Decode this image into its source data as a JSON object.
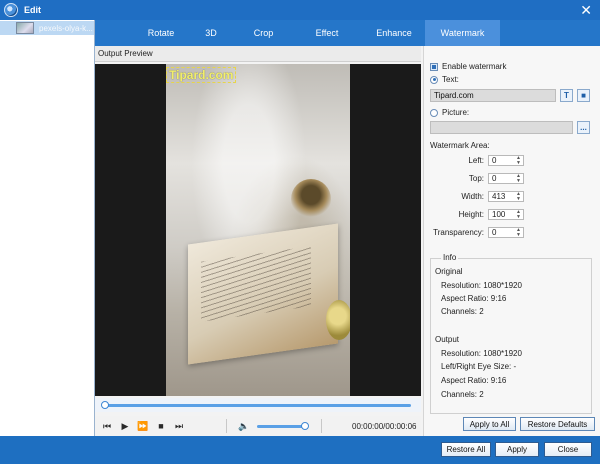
{
  "window": {
    "title": "Edit"
  },
  "file_list": {
    "items": [
      {
        "name": "pexels-olya-k..."
      }
    ]
  },
  "tabs": [
    {
      "label": "Rotate",
      "active": false
    },
    {
      "label": "3D",
      "active": false
    },
    {
      "label": "Crop",
      "active": false
    },
    {
      "label": "Effect",
      "active": false
    },
    {
      "label": "Enhance",
      "active": false
    },
    {
      "label": "Watermark",
      "active": true
    }
  ],
  "preview": {
    "header": "Output Preview",
    "watermark_text": "Tipard.com"
  },
  "playback": {
    "time": "00:00:00/00:00:06",
    "seek_progress": 0.0,
    "volume_level": 1.0
  },
  "watermark": {
    "enable_label": "Enable watermark",
    "enable_checked": true,
    "text_label": "Text:",
    "text_selected": true,
    "text_value": "Tipard.com",
    "text_font_btn": "T",
    "text_color_btn": "■",
    "picture_label": "Picture:",
    "picture_selected": false,
    "picture_value": "",
    "browse_btn": "...",
    "area_label": "Watermark Area:",
    "left_label": "Left:",
    "left_value": "0",
    "top_label": "Top:",
    "top_value": "0",
    "width_label": "Width:",
    "width_value": "413",
    "height_label": "Height:",
    "height_value": "100",
    "transparency_label": "Transparency:",
    "transparency_value": "0"
  },
  "info": {
    "title": "Info",
    "original_label": "Original",
    "original_resolution": "Resolution: 1080*1920",
    "original_aspect": "Aspect Ratio: 9:16",
    "original_channels": "Channels: 2",
    "output_label": "Output",
    "output_resolution": "Resolution: 1080*1920",
    "output_eye": "Left/Right Eye Size: -",
    "output_aspect": "Aspect Ratio: 9:16",
    "output_channels": "Channels: 2"
  },
  "buttons": {
    "apply_to_all": "Apply to All",
    "restore_defaults": "Restore Defaults",
    "restore_all": "Restore All",
    "apply": "Apply",
    "close": "Close"
  }
}
